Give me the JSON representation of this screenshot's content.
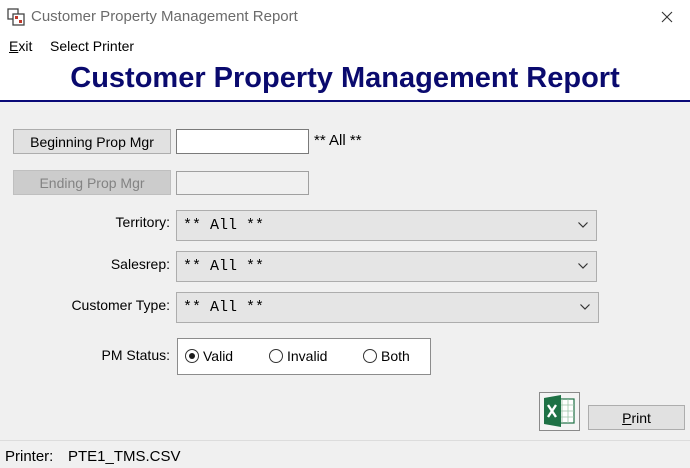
{
  "window": {
    "title": "Customer Property Management Report",
    "close_glyph": "✕"
  },
  "menu": {
    "items": [
      {
        "label": "Exit",
        "mnemonic": "E",
        "rest": "xit"
      },
      {
        "label": "Select Printer"
      }
    ]
  },
  "header": {
    "title": "Customer Property Management Report"
  },
  "form": {
    "beginning_btn": "Beginning Prop Mgr",
    "beginning_value": "",
    "beginning_hint": "** All **",
    "ending_btn": "Ending Prop Mgr",
    "ending_value": "",
    "territory_label": "Territory:",
    "territory_value": "** All **",
    "salesrep_label": "Salesrep:",
    "salesrep_value": "** All **",
    "customer_type_label": "Customer Type:",
    "customer_type_value": "** All **",
    "pm_status_label": "PM Status:",
    "pm_status_options": [
      {
        "label": "Valid",
        "checked": true
      },
      {
        "label": "Invalid",
        "checked": false
      },
      {
        "label": "Both",
        "checked": false
      }
    ]
  },
  "actions": {
    "excel_icon": "excel-icon",
    "print_label": "Print",
    "print_mnemonic": "P",
    "print_rest": "rint"
  },
  "status": {
    "printer_label": "Printer:",
    "printer_value": "PTE1_TMS.CSV"
  },
  "colors": {
    "header_title": "#0a0a6e",
    "header_rule": "#0a0a78",
    "excel_green": "#1e7145"
  }
}
